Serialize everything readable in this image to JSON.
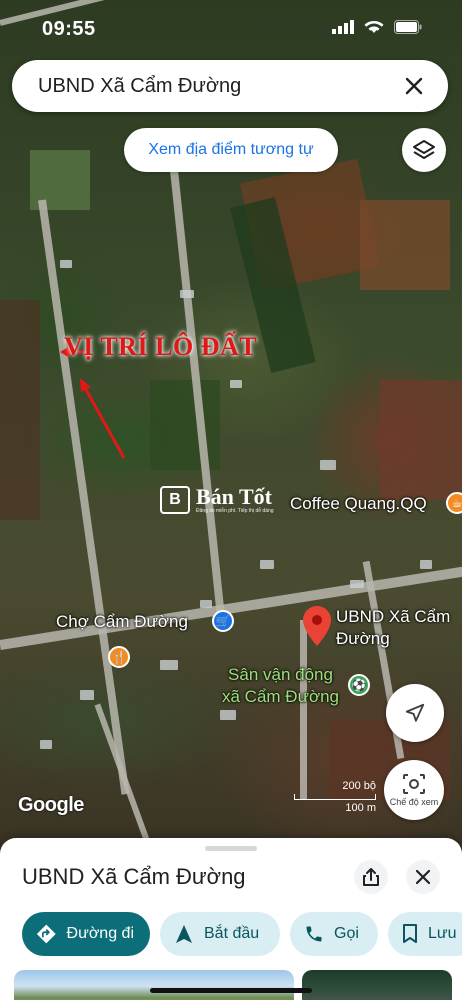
{
  "status_bar": {
    "time": "09:55"
  },
  "search": {
    "query": "UBND Xã Cẩm Đường"
  },
  "map": {
    "similar_button": "Xem địa điểm tương tự",
    "annotation": "VỊ TRÍ LÔ ĐẤT",
    "watermark": {
      "logo_letter": "B",
      "title": "Bán Tốt",
      "subtitle": "Đăng tin miễn phí. Tiếp thị dễ dàng"
    },
    "poi": {
      "coffee": "Coffee Quang.QQ",
      "market": "Chợ Cẩm Đường",
      "ubnd_line1": "UBND Xã Cẩm",
      "ubnd_line2": "Đường",
      "stadium_line1": "Sân vận động",
      "stadium_line2": "xã Cẩm Đường"
    },
    "view_mode_label": "Chế độ xem",
    "google_logo": "Google",
    "scale": {
      "top": "200 bộ",
      "bottom": "100 m"
    }
  },
  "sheet": {
    "title": "UBND Xã Cẩm Đường",
    "actions": {
      "directions": "Đường đi",
      "start": "Bắt đầu",
      "call": "Gọi",
      "save": "Lưu"
    }
  },
  "colors": {
    "accent": "#0b6e78",
    "pin": "#ea4335",
    "link": "#1a73e8",
    "annotation": "#e01818"
  },
  "icons": [
    "search-close-icon",
    "layers-icon",
    "navigation-arrow-icon",
    "camera-view-icon",
    "share-icon",
    "close-icon",
    "directions-icon",
    "start-navigation-icon",
    "phone-icon",
    "bookmark-icon"
  ]
}
